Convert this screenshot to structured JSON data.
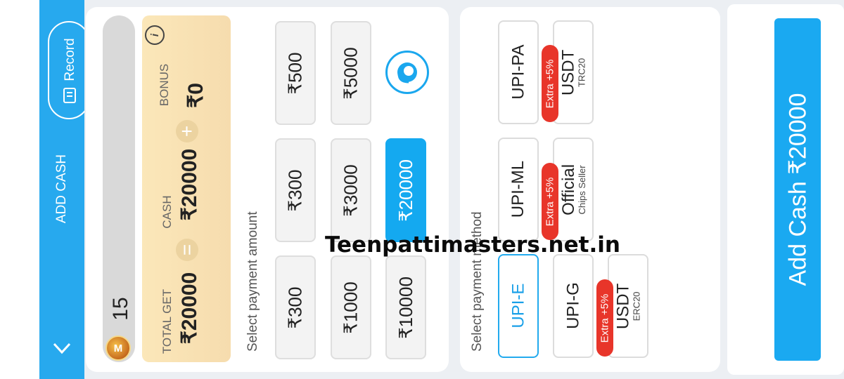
{
  "header": {
    "title": "ADD CASH",
    "record_label": "Record",
    "back_icon": "chevron-down-icon"
  },
  "wallet": {
    "coin_value": "15",
    "total_get_label": "TOTAL GET",
    "total_get_value": "₹20000",
    "equals": "=",
    "cash_label": "CASH",
    "cash_value": "₹20000",
    "plus": "+",
    "bonus_label": "BONUS",
    "bonus_value": "₹0",
    "info_icon": "info-icon"
  },
  "amounts": {
    "label": "Select payment amount",
    "options": [
      "₹300",
      "₹1000",
      "₹10000",
      "₹300",
      "₹3000",
      "₹20000",
      "₹500",
      "₹5000"
    ],
    "selected": "₹20000"
  },
  "methods": {
    "label": "Select payment method",
    "options": [
      {
        "name": "UPI-E"
      },
      {
        "name": "UPI-G"
      },
      {
        "name": "USDT",
        "sub": "ERC20",
        "tag": "Extra +5%"
      },
      {
        "name": "UPI-ML"
      },
      {
        "name": "Official",
        "sub": "Chips Seller",
        "tag": "Extra +5%"
      },
      {
        "name": "UPI-PA"
      },
      {
        "name": "USDT",
        "sub": "TRC20",
        "tag": "Extra +5%"
      }
    ],
    "selected": "UPI-E"
  },
  "watermark": "Teenpattimasters.net.in",
  "cta": {
    "label": "Add Cash ₹20000"
  },
  "colors": {
    "accent": "#1aa9f1",
    "tag": "#e8352a",
    "gold": "#f8e1b3"
  }
}
